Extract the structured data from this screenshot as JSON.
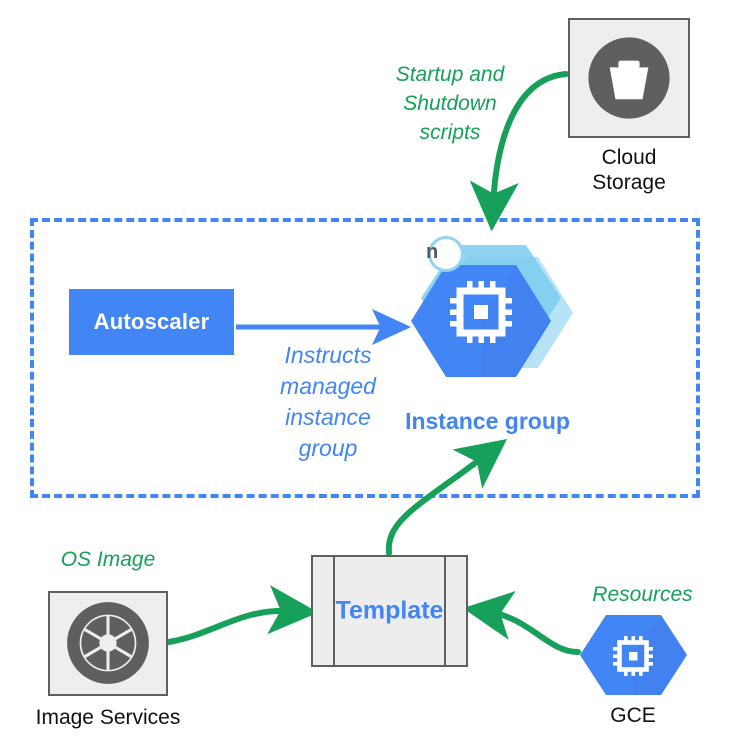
{
  "diagram": {
    "title": "Managed Instance Group architecture",
    "colors": {
      "google_blue": "#4285F4",
      "light_blue": "#8ed4f2",
      "green": "#17a05a",
      "gray_icon": "#5f5f5f",
      "gray_box_fill": "#eeeeee"
    }
  },
  "notes": {
    "startup_shutdown": "Startup and\nShutdown\nscripts",
    "instructs": "Instructs\nmanaged\ninstance\ngroup",
    "os_image": "OS Image",
    "resources": "Resources"
  },
  "nodes": {
    "cloud_storage": {
      "caption": "Cloud\nStorage",
      "icon": "cloud-storage-bucket-icon"
    },
    "instance_group": {
      "label": "Instance group",
      "badge": "n",
      "icon": "cpu-chip-icon"
    },
    "autoscaler": {
      "label": "Autoscaler"
    },
    "template": {
      "label": "Template"
    },
    "image_services": {
      "caption": "Image Services",
      "icon": "camera-aperture-icon"
    },
    "gce": {
      "caption": "GCE",
      "icon": "cpu-chip-icon"
    }
  },
  "edges": [
    {
      "name": "cloud-storage-to-instance-group",
      "from": "cloud_storage",
      "to": "instance_group",
      "color": "#17a05a",
      "label": "Startup and Shutdown scripts"
    },
    {
      "name": "autoscaler-to-instance-group",
      "from": "autoscaler",
      "to": "instance_group",
      "color": "#4285F4",
      "label": "Instructs managed instance group"
    },
    {
      "name": "template-to-instance-group",
      "from": "template",
      "to": "instance_group",
      "color": "#17a05a",
      "label": ""
    },
    {
      "name": "image-services-to-template",
      "from": "image_services",
      "to": "template",
      "color": "#17a05a",
      "label": "OS Image"
    },
    {
      "name": "gce-to-template",
      "from": "gce",
      "to": "template",
      "color": "#17a05a",
      "label": "Resources"
    }
  ],
  "container": {
    "name": "managed-instance-group-boundary",
    "style": "dashed",
    "color": "#4285F4"
  }
}
